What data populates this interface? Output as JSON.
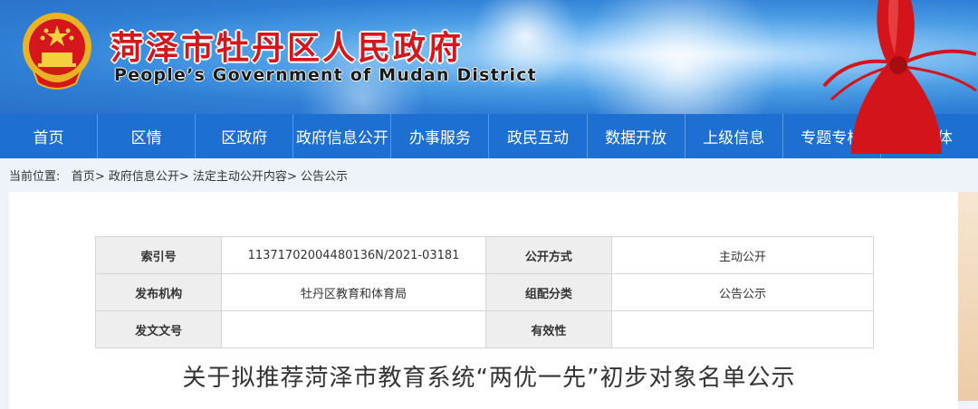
{
  "header": {
    "title": "菏泽市牡丹区人民政府",
    "subtitle": "People’s Government of Mudan District"
  },
  "nav": {
    "items": [
      "首页",
      "区情",
      "区政府",
      "政府信息公开",
      "办事服务",
      "政民互动",
      "数据开放",
      "上级信息",
      "专题专栏",
      "新媒体"
    ]
  },
  "breadcrumb": {
    "label": "当前位置:",
    "items": [
      "首页",
      "政府信息公开",
      "法定主动公开内容",
      "公告公示"
    ],
    "separator": ">"
  },
  "meta": {
    "index_label": "索引号",
    "index_value": "11371702004480136N/2021-03181",
    "method_label": "公开方式",
    "method_value": "主动公开",
    "org_label": "发布机构",
    "org_value": "牡丹区教育和体育局",
    "category_label": "组配分类",
    "category_value": "公告公示",
    "docno_label": "发文文号",
    "docno_value": "",
    "validity_label": "有效性",
    "validity_value": ""
  },
  "document": {
    "title": "关于拟推荐菏泽市教育系统“两优一先”初步对象名单公示"
  },
  "colors": {
    "nav_bg": "#1e6fd2",
    "title_red": "#d6161d"
  }
}
